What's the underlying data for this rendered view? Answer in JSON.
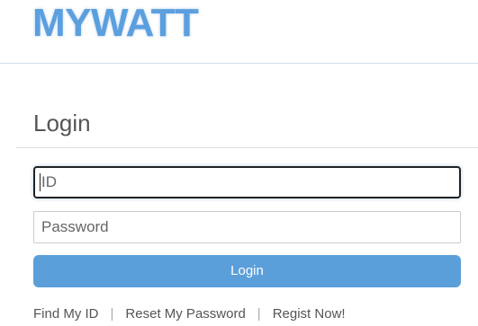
{
  "brand": {
    "logo_text": "MYWATT",
    "logo_color": "#5b9fde"
  },
  "login": {
    "heading": "Login",
    "id_field": {
      "value": "",
      "placeholder": "ID"
    },
    "password_field": {
      "value": "",
      "placeholder": "Password"
    },
    "submit_label": "Login",
    "accent_color": "#5b9fda"
  },
  "links": {
    "find_id": "Find My ID",
    "reset_password": "Reset My Password",
    "register": "Regist Now!",
    "separator": "|"
  }
}
